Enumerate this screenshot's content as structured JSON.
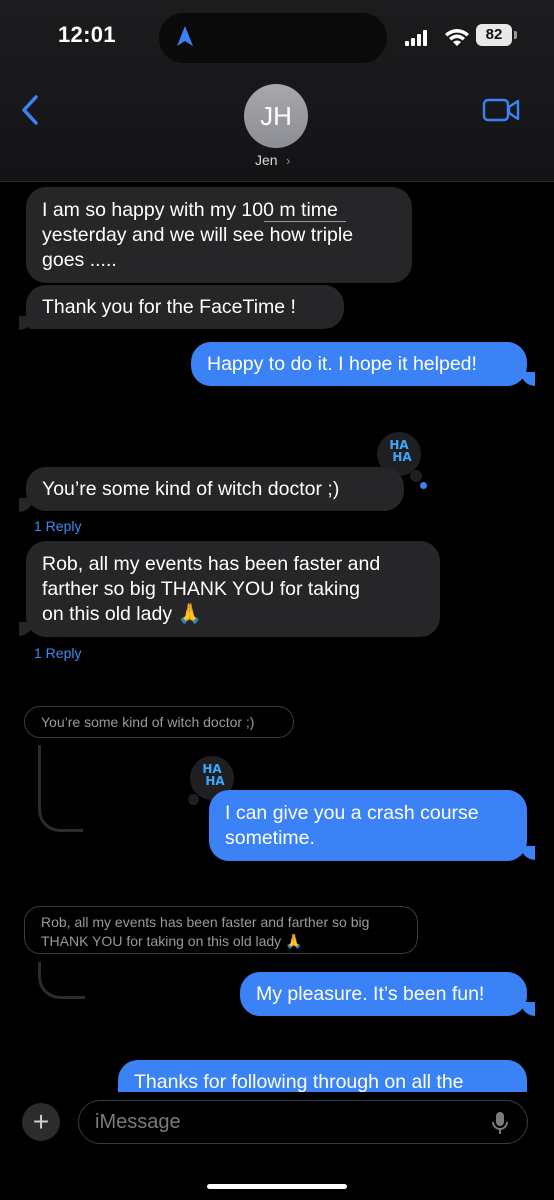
{
  "status": {
    "time": "12:01",
    "battery": "82"
  },
  "header": {
    "avatar_initials": "JH",
    "contact_name": "Jen"
  },
  "messages": {
    "m1": [
      "I am so happy with my 100 m time",
      "yesterday and we will see how triple",
      "goes ....."
    ],
    "m2": "Thank you for the FaceTime !",
    "m3": "Happy to do it. I hope it helped!",
    "m4": "You’re some kind of witch doctor ;)",
    "m4_reply": "1 Reply",
    "m5": [
      "Rob, all my events  has been faster and",
      "farther so big THANK YOU for taking",
      "on this old lady 🙏"
    ],
    "m5_reply": "1 Reply",
    "quote1": "You’re some kind of witch doctor ;)",
    "m6": [
      "I can give you a crash course",
      "sometime."
    ],
    "quote2": [
      "Rob, all my events  has been faster and farther so big",
      "THANK YOU for taking on this old lady 🙏"
    ],
    "m7": "My pleasure. It’s been fun!",
    "m8": "Thanks for following through on all the"
  },
  "reactions": {
    "haha_top": "HA",
    "haha_bottom": "HA"
  },
  "composer": {
    "placeholder": "iMessage",
    "plus": "+"
  },
  "colors": {
    "accent": "#3b82f6",
    "incoming": "#262628",
    "background": "#000000"
  }
}
